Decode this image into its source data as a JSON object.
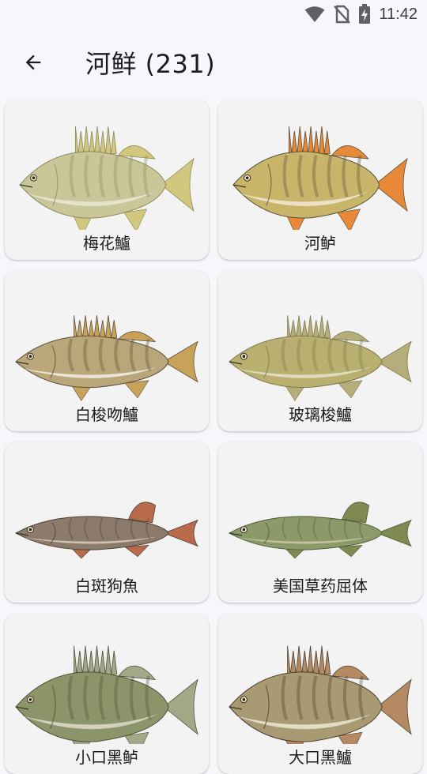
{
  "status": {
    "time": "11:42"
  },
  "header": {
    "title": "河鲜 (231)"
  },
  "fish": [
    {
      "name": "梅花鱸",
      "body": "#c9c79a",
      "belly": "#e8e6cf",
      "fin": "#d2c77e",
      "stripe": "#8c8a5a",
      "kind": "perch"
    },
    {
      "name": "河鲈",
      "body": "#c9b56a",
      "belly": "#efe6cf",
      "fin": "#e8893a",
      "stripe": "#55503a",
      "kind": "perch"
    },
    {
      "name": "白梭吻鱸",
      "body": "#b9a77a",
      "belly": "#efebe3",
      "fin": "#c9a25a",
      "stripe": "#5d503a",
      "kind": "zander"
    },
    {
      "name": "玻璃梭鱸",
      "body": "#b9b070",
      "belly": "#e4e0c6",
      "fin": "#b5ae7a",
      "stripe": "#7e7850",
      "kind": "zander"
    },
    {
      "name": "白斑狗魚",
      "body": "#8c7a6a",
      "belly": "#d6ccc0",
      "fin": "#b86a4a",
      "stripe": "#4a4038",
      "kind": "pike"
    },
    {
      "name": "美国草药屈体",
      "body": "#8c9a6a",
      "belly": "#c8c9a8",
      "fin": "#7e8a52",
      "stripe": "#4d5a36",
      "kind": "pike"
    },
    {
      "name": "小口黑鲈",
      "body": "#8c946a",
      "belly": "#d8d8c4",
      "fin": "#a4a888",
      "stripe": "#4a5238",
      "kind": "bass"
    },
    {
      "name": "大口黑鱸",
      "body": "#a89a72",
      "belly": "#e8e2cf",
      "fin": "#b58a62",
      "stripe": "#4a4030",
      "kind": "bass"
    }
  ]
}
